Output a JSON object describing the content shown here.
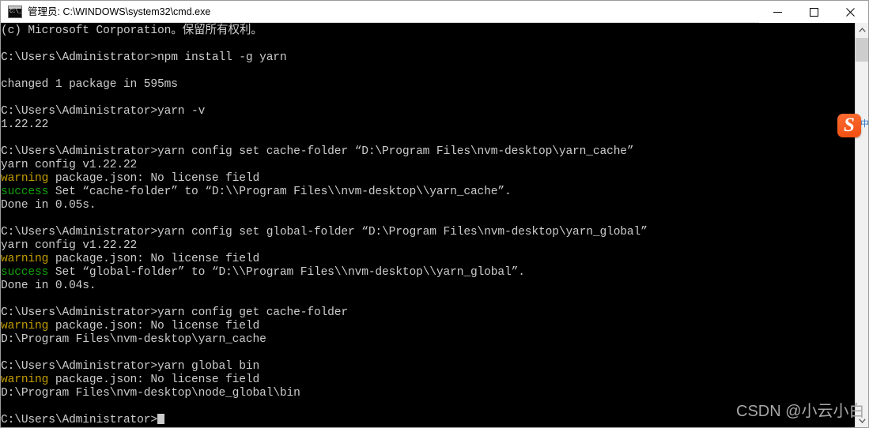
{
  "window": {
    "title": "管理员: C:\\WINDOWS\\system32\\cmd.exe",
    "app_icon_prompt": "C:\\_",
    "background": "#000000",
    "foreground": "#cccccc"
  },
  "titlebar_buttons": {
    "minimize_label": "—",
    "maximize_label": "□",
    "close_label": "✕"
  },
  "colors": {
    "warning": "#c19c00",
    "success": "#13a10e",
    "text": "#cccccc",
    "accent_ime": "#f04e0f"
  },
  "console": {
    "lines": [
      {
        "segments": [
          {
            "text": "(c) Microsoft Corporation。保留所有权利。"
          }
        ]
      },
      {
        "segments": [
          {
            "text": ""
          }
        ]
      },
      {
        "segments": [
          {
            "text": "C:\\Users\\Administrator>npm install -g yarn"
          }
        ]
      },
      {
        "segments": [
          {
            "text": ""
          }
        ]
      },
      {
        "segments": [
          {
            "text": "changed 1 package in 595ms"
          }
        ]
      },
      {
        "segments": [
          {
            "text": ""
          }
        ]
      },
      {
        "segments": [
          {
            "text": "C:\\Users\\Administrator>yarn -v"
          }
        ]
      },
      {
        "segments": [
          {
            "text": "1.22.22"
          }
        ]
      },
      {
        "segments": [
          {
            "text": ""
          }
        ]
      },
      {
        "segments": [
          {
            "text": "C:\\Users\\Administrator>yarn config set cache-folder “D:\\Program Files\\nvm-desktop\\yarn_cache”"
          }
        ]
      },
      {
        "segments": [
          {
            "text": "yarn config v1.22.22"
          }
        ]
      },
      {
        "segments": [
          {
            "text": "warning",
            "class": "c-warn"
          },
          {
            "text": " package.json: No license field"
          }
        ]
      },
      {
        "segments": [
          {
            "text": "success",
            "class": "c-ok"
          },
          {
            "text": " Set “cache-folder” to “D:\\\\Program Files\\\\nvm-desktop\\\\yarn_cache”."
          }
        ]
      },
      {
        "segments": [
          {
            "text": "Done in 0.05s."
          }
        ]
      },
      {
        "segments": [
          {
            "text": ""
          }
        ]
      },
      {
        "segments": [
          {
            "text": "C:\\Users\\Administrator>yarn config set global-folder “D:\\Program Files\\nvm-desktop\\yarn_global”"
          }
        ]
      },
      {
        "segments": [
          {
            "text": "yarn config v1.22.22"
          }
        ]
      },
      {
        "segments": [
          {
            "text": "warning",
            "class": "c-warn"
          },
          {
            "text": " package.json: No license field"
          }
        ]
      },
      {
        "segments": [
          {
            "text": "success",
            "class": "c-ok"
          },
          {
            "text": " Set “global-folder” to “D:\\\\Program Files\\\\nvm-desktop\\\\yarn_global”."
          }
        ]
      },
      {
        "segments": [
          {
            "text": "Done in 0.04s."
          }
        ]
      },
      {
        "segments": [
          {
            "text": ""
          }
        ]
      },
      {
        "segments": [
          {
            "text": "C:\\Users\\Administrator>yarn config get cache-folder"
          }
        ]
      },
      {
        "segments": [
          {
            "text": "warning",
            "class": "c-warn"
          },
          {
            "text": " package.json: No license field"
          }
        ]
      },
      {
        "segments": [
          {
            "text": "D:\\Program Files\\nvm-desktop\\yarn_cache"
          }
        ]
      },
      {
        "segments": [
          {
            "text": ""
          }
        ]
      },
      {
        "segments": [
          {
            "text": "C:\\Users\\Administrator>yarn global bin"
          }
        ]
      },
      {
        "segments": [
          {
            "text": "warning",
            "class": "c-warn"
          },
          {
            "text": " package.json: No license field"
          }
        ]
      },
      {
        "segments": [
          {
            "text": "D:\\Program Files\\nvm-desktop\\node_global\\bin"
          }
        ]
      },
      {
        "segments": [
          {
            "text": ""
          }
        ]
      },
      {
        "segments": [
          {
            "text": "C:\\Users\\Administrator>",
            "cursor": true
          }
        ]
      }
    ]
  },
  "scrollbar": {
    "up_arrow": "▲",
    "down_arrow": "▼"
  },
  "ime": {
    "logo_letter": "S",
    "tail_label": "中"
  },
  "watermark": {
    "text": "CSDN @小云小白"
  }
}
